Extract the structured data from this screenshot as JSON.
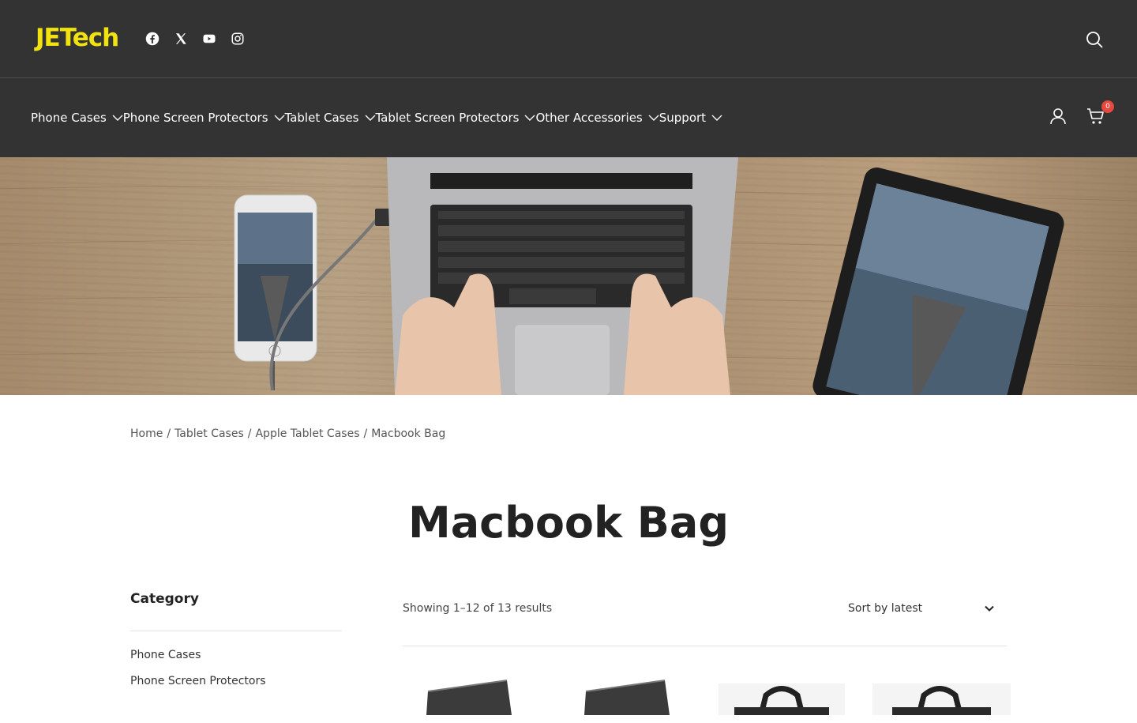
{
  "site": {
    "logo": "JETech"
  },
  "social_icons": [
    "facebook-icon",
    "x-icon",
    "youtube-icon",
    "instagram-icon"
  ],
  "nav": {
    "items": [
      {
        "label": "Phone Cases"
      },
      {
        "label": "Phone Screen Protectors"
      },
      {
        "label": "Tablet Cases"
      },
      {
        "label": "Tablet Screen Protectors"
      },
      {
        "label": "Other Accessories"
      },
      {
        "label": "Support"
      }
    ],
    "cart_count": "0"
  },
  "breadcrumb": {
    "items": [
      "Home",
      "Tablet Cases",
      "Apple Tablet Cases",
      "Macbook Bag"
    ],
    "separator": "/"
  },
  "page": {
    "title": "Macbook Bag"
  },
  "sidebar": {
    "title": "Category",
    "items": [
      "Phone Cases",
      "Phone Screen Protectors"
    ]
  },
  "shop": {
    "results_text": "Showing 1–12 of 13 results",
    "sort_label": "Sort by latest"
  },
  "colors": {
    "header_bg": "#333333",
    "logo": "#f2e30f",
    "cart_badge": "#e8493f"
  }
}
